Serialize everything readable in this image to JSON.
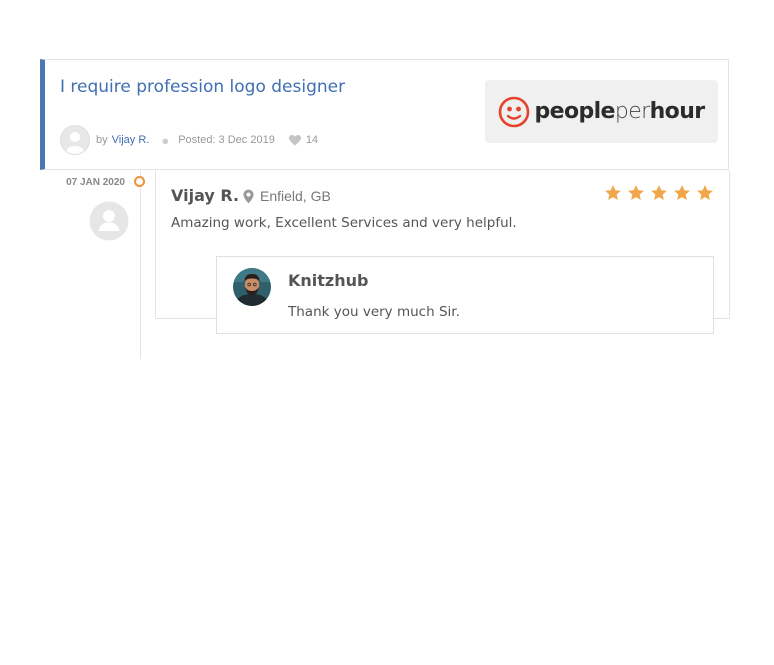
{
  "job": {
    "title": "I require profession logo designer",
    "by_label": "by",
    "author": "Vijay R.",
    "posted": "Posted: 3 Dec 2019",
    "likes": "14",
    "brand_parts": [
      "people",
      "per",
      "hour"
    ]
  },
  "review": {
    "date": "07 JAN 2020",
    "reviewer": "Vijay R.",
    "location": "Enfield, GB",
    "text": "Amazing work, Excellent Services and very helpful.",
    "rating": 5,
    "star_color": "#f2a64a"
  },
  "reply": {
    "name": "Knitzhub",
    "text": "Thank you very much Sir."
  },
  "colors": {
    "accent": "#4a78b5",
    "timeline_dot": "#f0923c",
    "brand_red": "#e8412c"
  },
  "icons": [
    "user-placeholder-icon",
    "heart-icon",
    "map-pin-icon",
    "star-icon",
    "peopleperhour-logo"
  ]
}
